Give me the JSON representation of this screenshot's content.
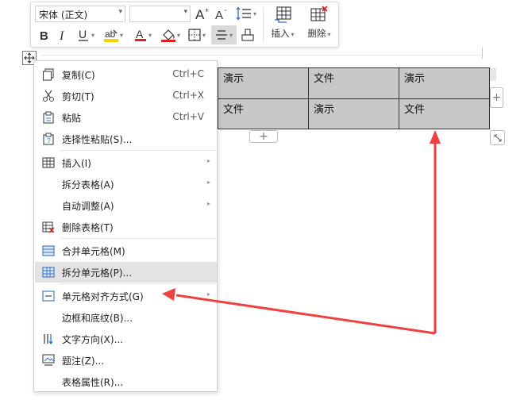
{
  "toolbar": {
    "font_name": "宋体 (正文)",
    "font_size": "",
    "insert_label": "插入",
    "delete_label": "删除",
    "accent_colors": {
      "highlight": "#f5d300",
      "font_color": "#e02020",
      "shading": "#e02020",
      "pressed_bg": "#d9d9d9"
    }
  },
  "table": {
    "rows": [
      [
        "演示",
        "文件",
        "演示"
      ],
      [
        "文件",
        "演示",
        "文件"
      ]
    ],
    "add_col": "+",
    "add_row": "+"
  },
  "context_menu": {
    "items": [
      {
        "label": "复制(C)",
        "shortcut": "Ctrl+C",
        "icon": "copy-icon"
      },
      {
        "label": "剪切(T)",
        "shortcut": "Ctrl+X",
        "icon": "cut-icon"
      },
      {
        "label": "粘贴",
        "shortcut": "Ctrl+V",
        "icon": "paste-icon"
      },
      {
        "label": "选择性粘贴(S)...",
        "shortcut": "",
        "icon": "paste-special-icon"
      },
      {
        "label": "插入(I)",
        "shortcut": "",
        "icon": "table-insert-icon",
        "submenu": true
      },
      {
        "label": "拆分表格(A)",
        "shortcut": "",
        "submenu": true
      },
      {
        "label": "自动调整(A)",
        "shortcut": "",
        "submenu": true
      },
      {
        "label": "删除表格(T)",
        "shortcut": "",
        "icon": "delete-table-icon"
      },
      {
        "label": "合并单元格(M)",
        "shortcut": "",
        "icon": "merge-cells-icon"
      },
      {
        "label": "拆分单元格(P)...",
        "shortcut": "",
        "icon": "split-cells-icon",
        "highlighted": true
      },
      {
        "label": "单元格对齐方式(G)",
        "shortcut": "",
        "icon": "cell-align-icon",
        "submenu": true
      },
      {
        "label": "边框和底纹(B)...",
        "shortcut": ""
      },
      {
        "label": "文字方向(X)...",
        "shortcut": "",
        "icon": "text-direction-icon"
      },
      {
        "label": "题注(Z)...",
        "shortcut": "",
        "icon": "caption-icon"
      },
      {
        "label": "表格属性(R)...",
        "shortcut": ""
      }
    ]
  },
  "annotation_color": "#f04040"
}
